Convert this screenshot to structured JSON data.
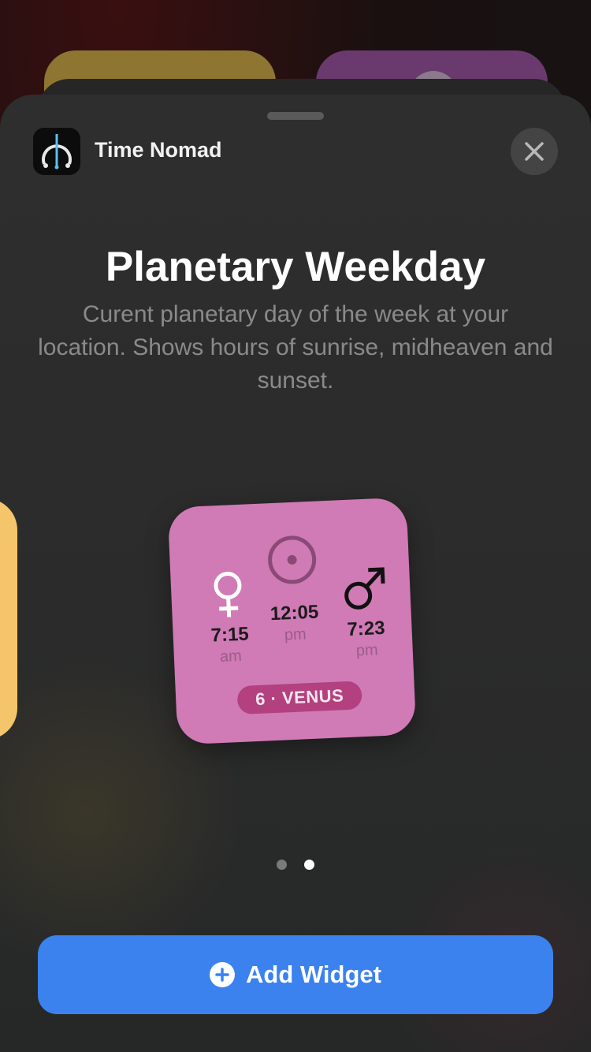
{
  "app": {
    "name": "Time Nomad"
  },
  "widget_info": {
    "title": "Planetary Weekday",
    "description": "Curent planetary day of the week at your location. Shows hours of sunrise, midheaven and sunset."
  },
  "widget_preview": {
    "sunrise": {
      "symbol": "venus-icon",
      "time": "7:15",
      "period": "am"
    },
    "midheaven": {
      "symbol": "sun-icon",
      "time": "12:05",
      "period": "pm"
    },
    "sunset": {
      "symbol": "mars-icon",
      "time": "7:23",
      "period": "pm"
    },
    "day_label": "6 · VENUS"
  },
  "pagination": {
    "total": 2,
    "current": 2
  },
  "actions": {
    "add_widget_label": "Add Widget"
  },
  "colors": {
    "accent": "#3b82ee",
    "widget_bg": "#d07ab6",
    "pill_bg": "#b3407f",
    "side_widget": "#f4c56b"
  }
}
